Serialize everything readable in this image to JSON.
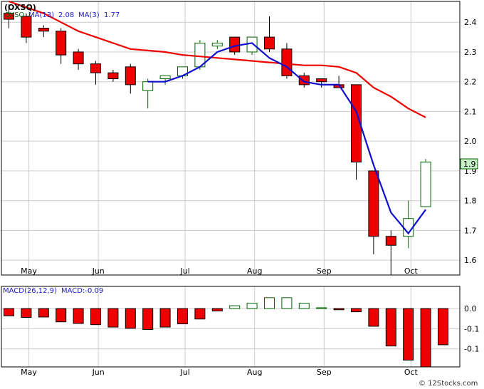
{
  "header": {
    "title": "(OXSQ)",
    "legend": [
      {
        "label": "OXSQ",
        "color": "#006400"
      },
      {
        "label": "MA(13)",
        "color": "#1a1acc"
      },
      {
        "label": "2.08",
        "color": "#1a1acc"
      },
      {
        "label": "MA(3)",
        "color": "#1a1acc"
      },
      {
        "label": "1.77",
        "color": "#1a1acc"
      }
    ]
  },
  "macd_legend": [
    {
      "label": "MACD(26,12,9)",
      "color": "#1a1acc"
    },
    {
      "label": "MACD:-0.09",
      "color": "#1a1acc"
    }
  ],
  "last_price_label": "1.9",
  "watermark": "© 12Stocks.com",
  "colors": {
    "up_fill": "#ffffff",
    "up_stroke": "#006400",
    "down_fill": "#ee0000",
    "down_stroke": "#000000",
    "ma13": "#ee0000",
    "ma3": "#1010cc",
    "grid": "#cccccc",
    "price_tag_bg": "#c8f0c8",
    "panel_border": "#000000"
  },
  "chart_data": [
    {
      "type": "candlestick",
      "ylim": [
        1.55,
        2.47
      ],
      "yticks": [
        "1.6",
        "1.7",
        "1.8",
        "1.9",
        "2.0",
        "2.1",
        "2.2",
        "2.3",
        "2.4"
      ],
      "ytick_values": [
        1.6,
        1.7,
        1.8,
        1.9,
        2.0,
        2.1,
        2.2,
        2.3,
        2.4
      ],
      "xtick_labels": [
        "May",
        "Jun",
        "Jul",
        "Aug",
        "Sep",
        "Oct"
      ],
      "xtick_bar_index": [
        1.15,
        5.15,
        10.15,
        14.15,
        18.15,
        23.15
      ],
      "bars": [
        {
          "o": 2.43,
          "h": 2.46,
          "l": 2.38,
          "c": 2.41
        },
        {
          "o": 2.42,
          "h": 2.43,
          "l": 2.33,
          "c": 2.35
        },
        {
          "o": 2.38,
          "h": 2.39,
          "l": 2.35,
          "c": 2.37
        },
        {
          "o": 2.37,
          "h": 2.38,
          "l": 2.26,
          "c": 2.29
        },
        {
          "o": 2.3,
          "h": 2.31,
          "l": 2.24,
          "c": 2.26
        },
        {
          "o": 2.26,
          "h": 2.27,
          "l": 2.19,
          "c": 2.23
        },
        {
          "o": 2.23,
          "h": 2.24,
          "l": 2.2,
          "c": 2.21
        },
        {
          "o": 2.25,
          "h": 2.26,
          "l": 2.16,
          "c": 2.19
        },
        {
          "o": 2.17,
          "h": 2.21,
          "l": 2.11,
          "c": 2.2
        },
        {
          "o": 2.21,
          "h": 2.22,
          "l": 2.19,
          "c": 2.22
        },
        {
          "o": 2.22,
          "h": 2.25,
          "l": 2.21,
          "c": 2.25
        },
        {
          "o": 2.25,
          "h": 2.34,
          "l": 2.24,
          "c": 2.33
        },
        {
          "o": 2.32,
          "h": 2.34,
          "l": 2.31,
          "c": 2.33
        },
        {
          "o": 2.35,
          "h": 2.35,
          "l": 2.29,
          "c": 2.3
        },
        {
          "o": 2.3,
          "h": 2.35,
          "l": 2.29,
          "c": 2.35
        },
        {
          "o": 2.35,
          "h": 2.42,
          "l": 2.3,
          "c": 2.31
        },
        {
          "o": 2.31,
          "h": 2.33,
          "l": 2.21,
          "c": 2.22
        },
        {
          "o": 2.22,
          "h": 2.23,
          "l": 2.18,
          "c": 2.19
        },
        {
          "o": 2.21,
          "h": 2.21,
          "l": 2.18,
          "c": 2.2
        },
        {
          "o": 2.19,
          "h": 2.22,
          "l": 2.18,
          "c": 2.18
        },
        {
          "o": 2.19,
          "h": 2.19,
          "l": 1.87,
          "c": 1.93
        },
        {
          "o": 1.9,
          "h": 1.9,
          "l": 1.62,
          "c": 1.68
        },
        {
          "o": 1.68,
          "h": 1.7,
          "l": 1.55,
          "c": 1.65
        },
        {
          "o": 1.68,
          "h": 1.8,
          "l": 1.64,
          "c": 1.74
        },
        {
          "o": 1.78,
          "h": 1.94,
          "l": 1.78,
          "c": 1.93
        }
      ],
      "ma13": {
        "x": [
          0,
          1,
          2,
          3,
          4,
          5,
          6,
          7,
          8,
          9,
          10,
          11,
          12,
          13,
          14,
          15,
          16,
          17,
          18,
          19,
          20,
          21,
          22,
          23,
          24
        ],
        "y": [
          2.47,
          2.45,
          2.43,
          2.4,
          2.37,
          2.35,
          2.33,
          2.31,
          2.305,
          2.3,
          2.29,
          2.285,
          2.28,
          2.275,
          2.27,
          2.265,
          2.26,
          2.255,
          2.255,
          2.25,
          2.23,
          2.18,
          2.15,
          2.11,
          2.08
        ]
      },
      "ma3": {
        "x": [
          8,
          9,
          10,
          11,
          12,
          13,
          14,
          15,
          16,
          17,
          18,
          19,
          20,
          21,
          22,
          23,
          24
        ],
        "y": [
          2.2,
          2.2,
          2.22,
          2.25,
          2.3,
          2.32,
          2.33,
          2.28,
          2.25,
          2.2,
          2.19,
          2.19,
          2.1,
          1.92,
          1.76,
          1.69,
          1.77
        ]
      }
    },
    {
      "type": "bar",
      "title": "MACD(26,12,9)",
      "ylim": [
        -0.145,
        0.055
      ],
      "yticks": [
        "0.0",
        "-0.1",
        "-0.1"
      ],
      "ytick_values": [
        0.0,
        -0.05,
        -0.1
      ],
      "xtick_labels": [
        "May",
        "Jun",
        "Jul",
        "Aug",
        "Sep",
        "Oct"
      ],
      "xtick_bar_index": [
        1.15,
        5.15,
        10.15,
        14.15,
        18.15,
        23.15
      ],
      "values": [
        -0.018,
        -0.022,
        -0.021,
        -0.033,
        -0.037,
        -0.04,
        -0.046,
        -0.049,
        -0.052,
        -0.046,
        -0.038,
        -0.026,
        -0.006,
        0.007,
        0.013,
        0.027,
        0.027,
        0.013,
        0.002,
        -0.003,
        -0.008,
        -0.044,
        -0.093,
        -0.128,
        -0.145,
        -0.09
      ]
    }
  ]
}
